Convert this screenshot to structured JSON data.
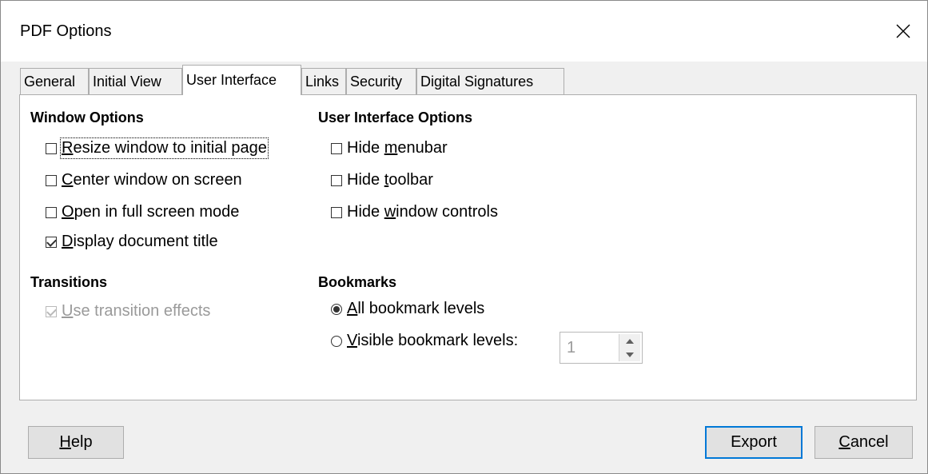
{
  "window": {
    "title": "PDF Options",
    "close_icon": "close-icon"
  },
  "tabs": [
    {
      "label": "General",
      "active": false
    },
    {
      "label": "Initial View",
      "active": false
    },
    {
      "label": "User Interface",
      "active": true
    },
    {
      "label": "Links",
      "active": false
    },
    {
      "label": "Security",
      "active": false
    },
    {
      "label": "Digital Signatures",
      "active": false
    }
  ],
  "window_options": {
    "title": "Window Options",
    "resize": {
      "pre": "",
      "key": "R",
      "post": "esize window to initial page",
      "checked": false
    },
    "center": {
      "pre": "",
      "key": "C",
      "post": "enter window on screen",
      "checked": false
    },
    "fullscreen": {
      "pre": "",
      "key": "O",
      "post": "pen in full screen mode",
      "checked": false
    },
    "doc_title": {
      "pre": "",
      "key": "D",
      "post": "isplay document title",
      "checked": true
    }
  },
  "ui_options": {
    "title": "User Interface Options",
    "menubar": {
      "pre": "Hide ",
      "key": "m",
      "post": "enubar",
      "checked": false
    },
    "toolbar": {
      "pre": "Hide ",
      "key": "t",
      "post": "oolbar",
      "checked": false
    },
    "window_controls": {
      "pre": "Hide ",
      "key": "w",
      "post": "indow controls",
      "checked": false
    }
  },
  "transitions": {
    "title": "Transitions",
    "use_effects": {
      "pre": "",
      "key": "U",
      "post": "se transition effects",
      "checked": true,
      "disabled": true
    }
  },
  "bookmarks": {
    "title": "Bookmarks",
    "all_levels": {
      "pre": "",
      "key": "A",
      "post": "ll bookmark levels",
      "selected": true
    },
    "visible_levels": {
      "pre": "",
      "key": "V",
      "post": "isible bookmark levels:",
      "selected": false
    },
    "levels_value": "1"
  },
  "buttons": {
    "help": {
      "key": "H",
      "post": "elp"
    },
    "export": {
      "label": "Export"
    },
    "cancel": {
      "key": "C",
      "post": "ancel"
    }
  },
  "colors": {
    "accent": "#0078d7",
    "panel_bg": "#ffffff",
    "dialog_bg": "#f0f0f0",
    "disabled_text": "#9a9a9a"
  }
}
